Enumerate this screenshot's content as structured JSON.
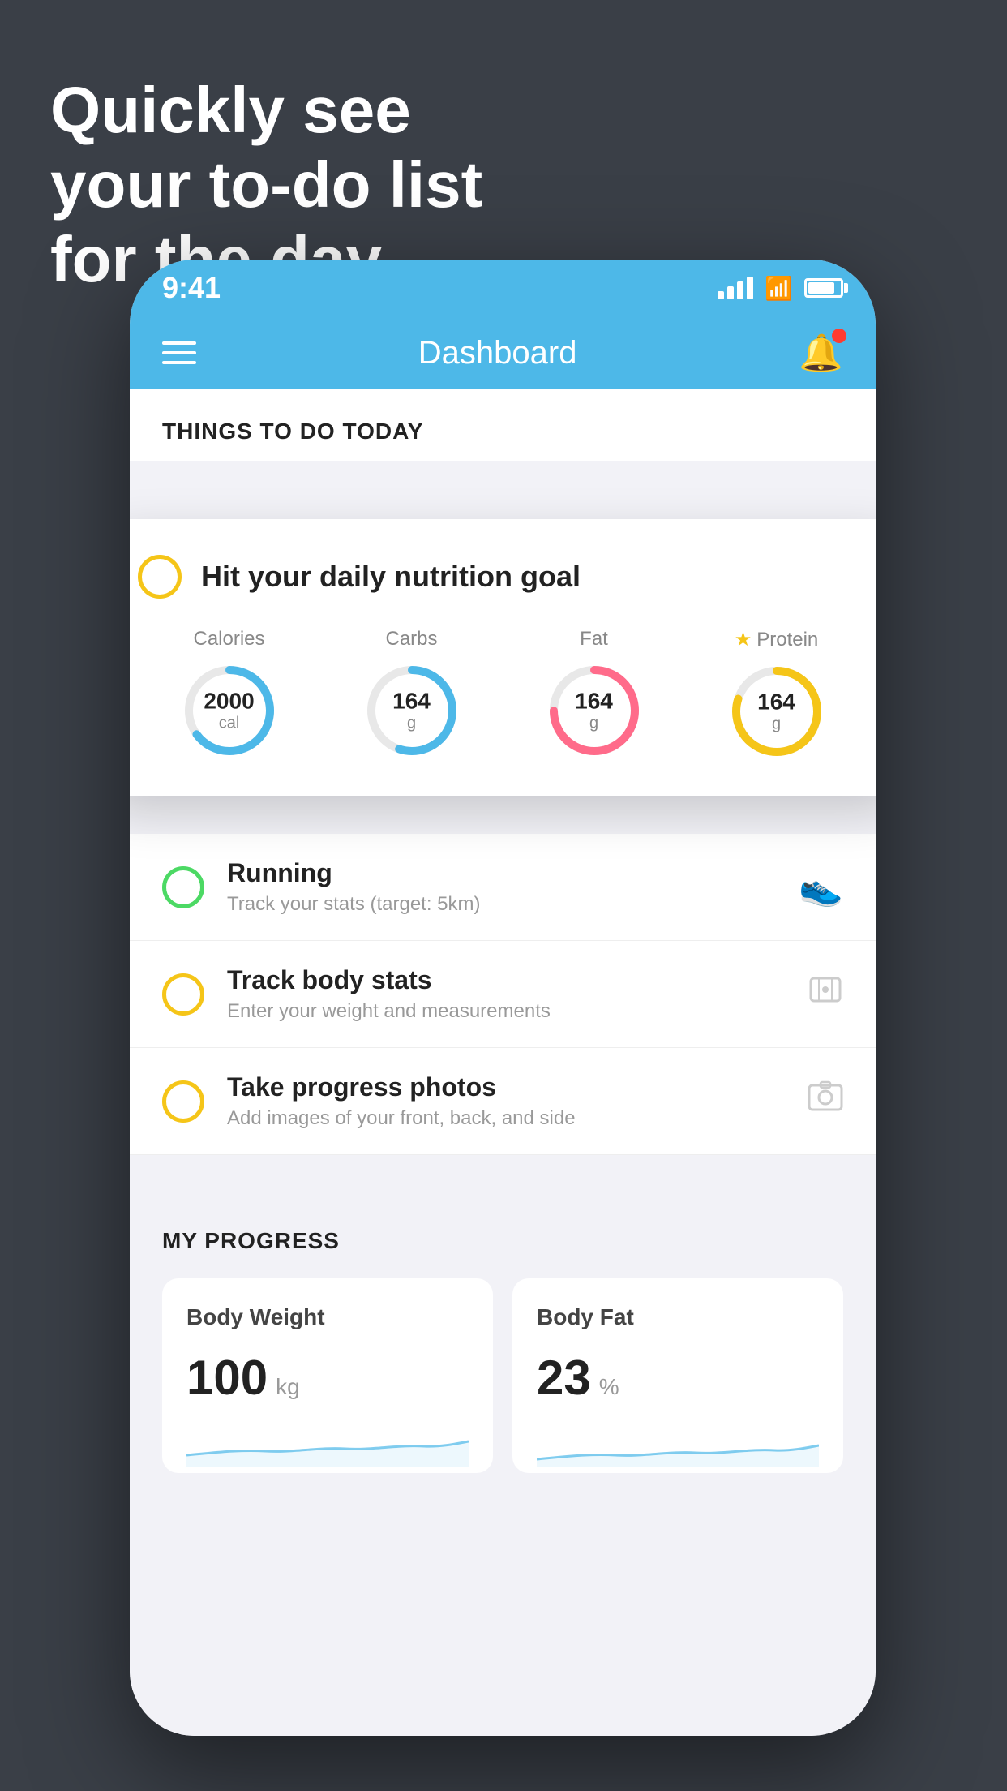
{
  "background": {
    "color": "#3a3f47"
  },
  "headline": {
    "line1": "Quickly see",
    "line2": "your to-do list",
    "line3": "for the day."
  },
  "status_bar": {
    "time": "9:41",
    "color": "#4db8e8"
  },
  "app_header": {
    "title": "Dashboard",
    "color": "#4db8e8"
  },
  "section": {
    "things_today": "THINGS TO DO TODAY"
  },
  "floating_card": {
    "title": "Hit your daily nutrition goal",
    "nutrition": [
      {
        "label": "Calories",
        "value": "2000",
        "unit": "cal",
        "color": "#4db8e8",
        "percent": 65
      },
      {
        "label": "Carbs",
        "value": "164",
        "unit": "g",
        "color": "#4db8e8",
        "percent": 55
      },
      {
        "label": "Fat",
        "value": "164",
        "unit": "g",
        "color": "#ff6b8a",
        "percent": 75
      },
      {
        "label": "Protein",
        "value": "164",
        "unit": "g",
        "color": "#f5c518",
        "percent": 80,
        "starred": true
      }
    ]
  },
  "todo_items": [
    {
      "title": "Running",
      "subtitle": "Track your stats (target: 5km)",
      "circle_color": "green",
      "icon": "shoe"
    },
    {
      "title": "Track body stats",
      "subtitle": "Enter your weight and measurements",
      "circle_color": "yellow",
      "icon": "scale"
    },
    {
      "title": "Take progress photos",
      "subtitle": "Add images of your front, back, and side",
      "circle_color": "yellow",
      "icon": "photo"
    }
  ],
  "progress": {
    "header": "MY PROGRESS",
    "cards": [
      {
        "title": "Body Weight",
        "value": "100",
        "unit": "kg"
      },
      {
        "title": "Body Fat",
        "value": "23",
        "unit": "%"
      }
    ]
  }
}
